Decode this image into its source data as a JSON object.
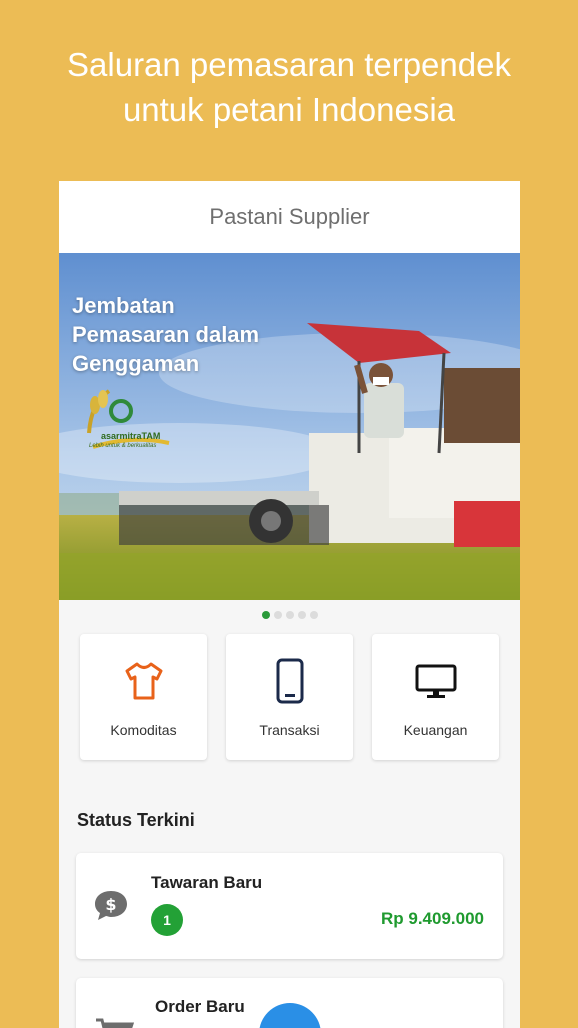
{
  "headline": {
    "line1": "Saluran pemasaran terpendek",
    "line2": "untuk petani Indonesia"
  },
  "app": {
    "title": "Pastani Supplier"
  },
  "banner": {
    "title": "Jembatan\nPemasaran dalam\nGenggaman",
    "logo_text": "asarmitraTAM",
    "logo_tagline": "Lebih untuk & berkualitas",
    "slide_count": 5,
    "active_slide": 1
  },
  "menu": [
    {
      "label": "Komoditas",
      "icon": "shirt-icon",
      "color": "#E8621A"
    },
    {
      "label": "Transaksi",
      "icon": "phone-icon",
      "color": "#1B2A4A"
    },
    {
      "label": "Keuangan",
      "icon": "monitor-icon",
      "color": "#111111"
    }
  ],
  "status": {
    "title": "Status Terkini",
    "items": [
      {
        "title": "Tawaran Baru",
        "count": "1",
        "amount": "Rp 9.409.000",
        "icon": "dollar-chat-icon"
      },
      {
        "title": "Order Baru",
        "icon": "cart-icon"
      }
    ]
  },
  "colors": {
    "background": "#ECBC55",
    "accent_green": "#23A136",
    "fab_blue": "#2A8FE6"
  }
}
